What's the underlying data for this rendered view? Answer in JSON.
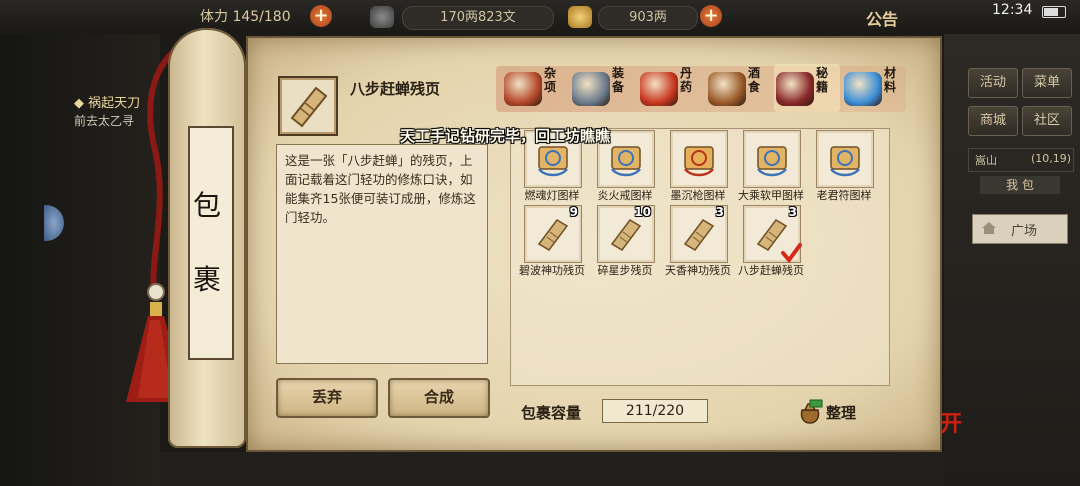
{
  "status_bar": {
    "stamina": "体力 145/180",
    "copper": "170两823文",
    "silver": "903两",
    "announcement": "公告",
    "time": "12:34"
  },
  "left_panel": {
    "quest_title": "◆ 祸起天刀",
    "quest_sub": "前去太乙寻"
  },
  "right_panel": {
    "buttons": [
      "活动",
      "菜单",
      "商城",
      "社区"
    ],
    "location": "嵩山",
    "coords": "(10,19)",
    "pack_tab": "我 包",
    "plaza": "广场",
    "leave": "离开"
  },
  "scroll": {
    "title_chars": [
      "包",
      "裹"
    ]
  },
  "selected_item": {
    "name": "八步赶蝉残页",
    "description": "这是一张「八步赶蝉」的残页，上面记载着这门轻功的修炼口诀，如能集齐15张便可装订成册，修炼这门轻功。"
  },
  "categories": [
    {
      "label": "杂项",
      "icon": "jar-icon",
      "color": "#b4482a"
    },
    {
      "label": "装备",
      "icon": "weapon-icon",
      "color": "#6b7a8c"
    },
    {
      "label": "丹药",
      "icon": "pill-plate-icon",
      "color": "#c8361e"
    },
    {
      "label": "酒食",
      "icon": "wine-food-icon",
      "color": "#9a5a2a"
    },
    {
      "label": "秘籍",
      "icon": "book-stack-icon",
      "color": "#8a2a2a"
    },
    {
      "label": "材料",
      "icon": "crystal-icon",
      "color": "#3d8fd6"
    }
  ],
  "active_category": "秘籍",
  "toast": "天工手记钻研完毕，回工坊瞧瞧",
  "actions": {
    "discard": "丢弃",
    "combine": "合成"
  },
  "items": [
    {
      "name": "燃魂灯图样",
      "kind": "blueprint",
      "count": ""
    },
    {
      "name": "炎火戒图样",
      "kind": "blueprint",
      "count": ""
    },
    {
      "name": "墨沉枪图样",
      "kind": "blueprint-red",
      "count": ""
    },
    {
      "name": "大乘软甲图样",
      "kind": "blueprint",
      "count": ""
    },
    {
      "name": "老君符图样",
      "kind": "blueprint",
      "count": ""
    },
    {
      "name": "碧波神功残页",
      "kind": "page",
      "count": "9"
    },
    {
      "name": "碎星步残页",
      "kind": "page",
      "count": "10"
    },
    {
      "name": "天香神功残页",
      "kind": "page",
      "count": "3"
    },
    {
      "name": "八步赶蝉残页",
      "kind": "page",
      "count": "3",
      "selected": true
    }
  ],
  "capacity": {
    "label": "包裹容量",
    "value": "211/220"
  },
  "sort_label": "整理"
}
